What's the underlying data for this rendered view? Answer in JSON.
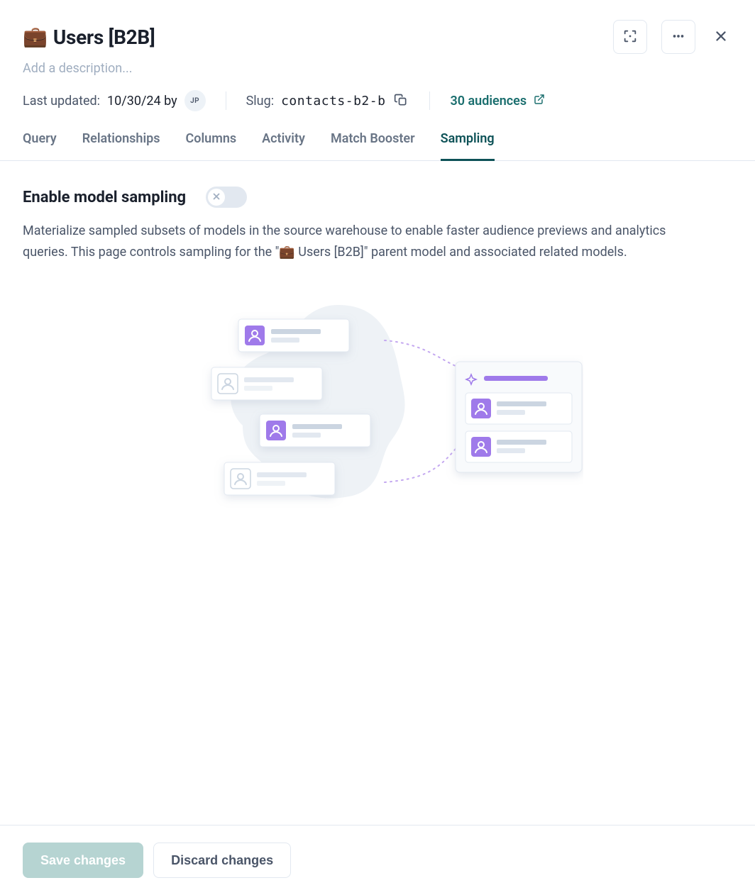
{
  "title": {
    "icon": "💼",
    "text": "Users [B2B]"
  },
  "description_placeholder": "Add a description...",
  "meta": {
    "last_updated_label": "Last updated:",
    "last_updated_value": "10/30/24 by",
    "author_initials": "JP",
    "slug_label": "Slug:",
    "slug_value": "contacts-b2-b",
    "audiences_link": "30 audiences"
  },
  "tabs": [
    {
      "label": "Query",
      "active": false
    },
    {
      "label": "Relationships",
      "active": false
    },
    {
      "label": "Columns",
      "active": false
    },
    {
      "label": "Activity",
      "active": false
    },
    {
      "label": "Match Booster",
      "active": false
    },
    {
      "label": "Sampling",
      "active": true
    }
  ],
  "sampling": {
    "title": "Enable model sampling",
    "toggle_on": false,
    "description": "Materialize sampled subsets of models in the source warehouse to enable faster audience previews and analytics queries. This page controls sampling for the \"💼 Users [B2B]\" parent model and associated related models."
  },
  "footer": {
    "save_label": "Save changes",
    "discard_label": "Discard changes"
  },
  "colors": {
    "teal": "#0d5257",
    "purple": "#9F7AEA"
  }
}
